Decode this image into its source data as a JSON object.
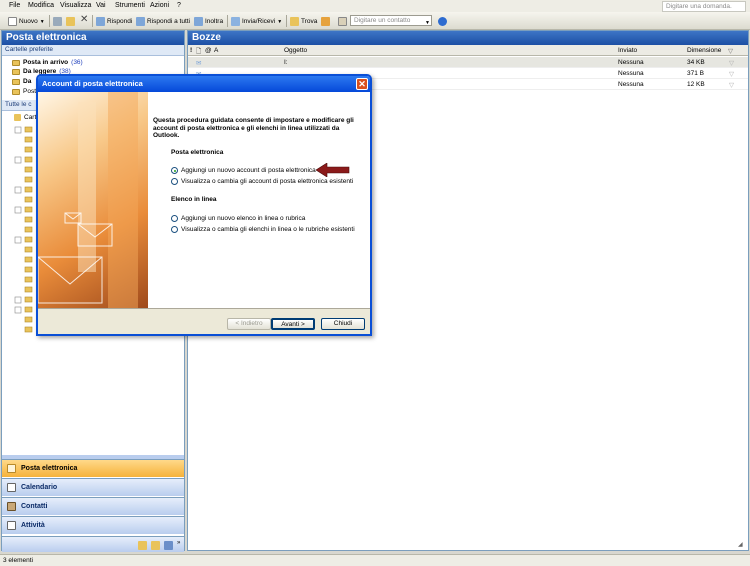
{
  "menu": [
    "File",
    "Modifica",
    "Visualizza",
    "Vai",
    "Strumenti",
    "Azioni",
    "?"
  ],
  "help_placeholder": "Digitare una domanda.",
  "toolbar": {
    "new_label": "Nuovo",
    "reply_label": "Rispondi",
    "reply_all_label": "Rispondi a tutti",
    "forward_label": "Inoltra",
    "send_receive_label": "Invia/Ricevi",
    "find_label": "Trova",
    "contact_placeholder": "Digitare un contatto"
  },
  "nav": {
    "title": "Posta elettronica",
    "favorites_header": "Cartelle preferite",
    "favorites": [
      {
        "label": "Posta in arrivo",
        "count": "(36)"
      },
      {
        "label": "Da leggere",
        "count": "(38)"
      },
      {
        "label": "Da",
        "count": ""
      },
      {
        "label": "Post",
        "count": ""
      }
    ],
    "all_header": "Tutte le c",
    "root_label": "Cart",
    "buttons": [
      "Posta elettronica",
      "Calendario",
      "Contatti",
      "Attività"
    ]
  },
  "main": {
    "title": "Bozze",
    "col_to": "A",
    "col_subject": "Oggetto",
    "col_sent": "Inviato",
    "col_size": "Dimensione",
    "rows": [
      {
        "to": "",
        "subject": "I:",
        "sent": "Nessuna",
        "size": "34 KB"
      },
      {
        "to": "",
        "subject": "",
        "sent": "Nessuna",
        "size": "371 B"
      },
      {
        "to": "",
        "subject": "",
        "sent": "Nessuna",
        "size": "12 KB"
      }
    ]
  },
  "status": "3 elementi",
  "dialog": {
    "title": "Account di posta elettronica",
    "intro": "Questa procedura guidata consente di impostare e modificare gli account di posta elettronica e gli elenchi in linea utilizzati da Outlook.",
    "email_section": "Posta elettronica",
    "opt_add_email": "Aggiungi un nuovo account di posta elettronica",
    "opt_view_email": "Visualizza o cambia gli account di posta elettronica esistenti",
    "directory_section": "Elenco in linea",
    "opt_add_dir": "Aggiungi un nuovo elenco in linea o rubrica",
    "opt_view_dir": "Visualizza o cambia gli elenchi in linea o le rubriche esistenti",
    "back_label": "< Indietro",
    "next_label": "Avanti >",
    "close_label": "Chiudi"
  },
  "colors": {
    "accent_blue": "#1c4fa4",
    "active_nav": "#f6b23a",
    "arrow": "#8b1a1a"
  }
}
